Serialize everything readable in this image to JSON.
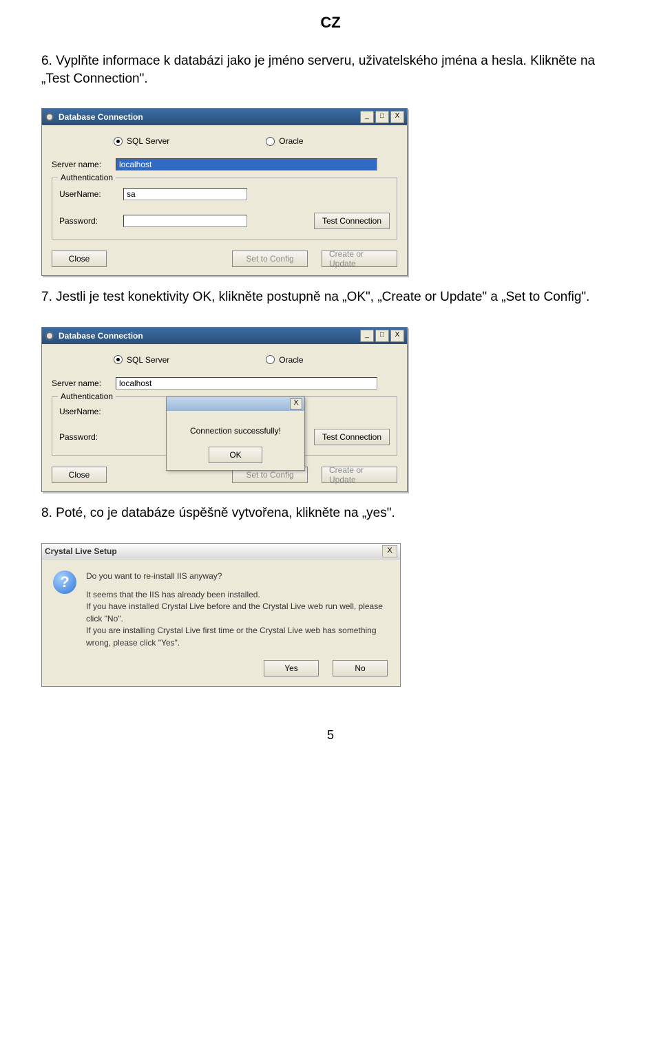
{
  "header": "CZ",
  "step6": {
    "num": "6.",
    "text": "Vyplňte informace k databázi jako je jméno serveru, uživatelského jména a hesla. Klikněte na „Test Connection\"."
  },
  "dialog1": {
    "title": "Database Connection",
    "minimize": "_",
    "maximize": "□",
    "close": "X",
    "sql_label": "SQL Server",
    "oracle_label": "Oracle",
    "server_label": "Server name:",
    "server_value": "localhost",
    "auth_legend": "Authentication",
    "user_label": "UserName:",
    "user_value": "sa",
    "pass_label": "Password:",
    "pass_value": "",
    "test_btn": "Test Connection",
    "close_btn": "Close",
    "setconfig_btn": "Set to Config",
    "create_btn": "Create or Update"
  },
  "step7": {
    "num": "7.",
    "text": "Jestli je test konektivity OK, klikněte postupně na „OK\", „Create or Update\" a „Set to Config\"."
  },
  "dialog2": {
    "title": "Database Connection",
    "minimize": "_",
    "maximize": "□",
    "close": "X",
    "sql_label": "SQL Server",
    "oracle_label": "Oracle",
    "server_label": "Server name:",
    "server_value": "localhost",
    "auth_legend": "Authentication",
    "user_label": "UserName:",
    "pass_label": "Password:",
    "test_btn": "Test Connection",
    "close_btn": "Close",
    "setconfig_btn": "Set to Config",
    "create_btn": "Create or Update",
    "popup_x": "X",
    "popup_text": "Connection successfully!",
    "popup_ok": "OK"
  },
  "step8": {
    "num": "8.",
    "text": "Poté, co je databáze úspěšně vytvořena, klikněte na „yes\"."
  },
  "dialog3": {
    "title": "Crystal Live Setup",
    "close": "X",
    "q": "?",
    "head": "Do you want to re-install IIS anyway?",
    "line1": "It seems that the IIS has already been installed.",
    "line2": "If you have installed Crystal Live before and the Crystal Live web run well, please click \"No\".",
    "line3": "If you are installing Crystal Live first time or the Crystal Live web has something wrong, please click \"Yes\".",
    "yes": "Yes",
    "no": "No"
  },
  "pagenum": "5"
}
